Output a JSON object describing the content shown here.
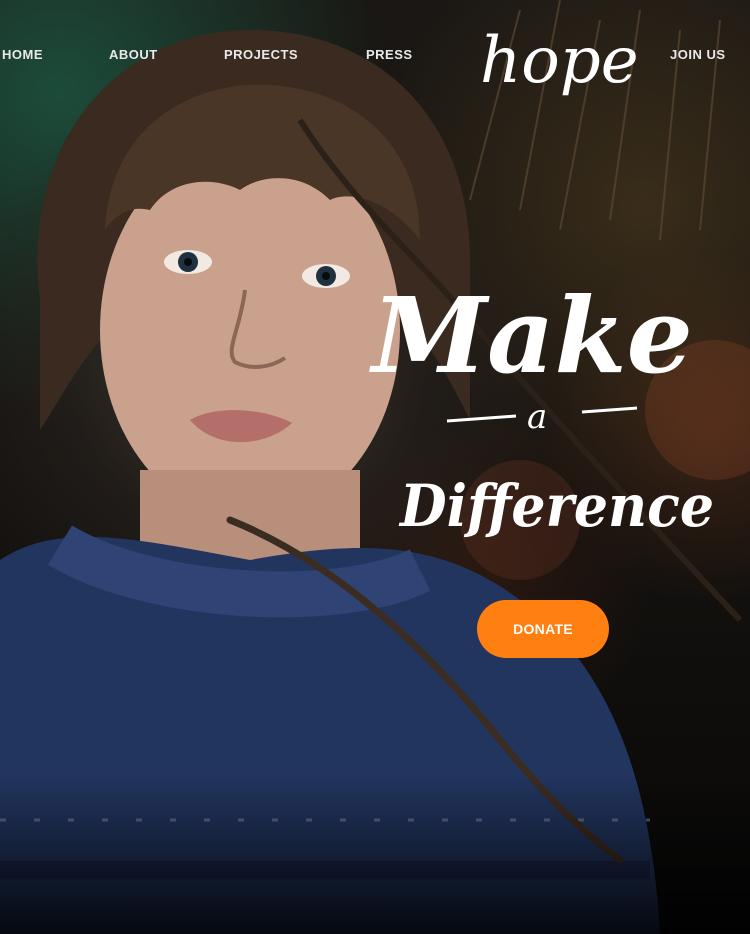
{
  "nav": {
    "items": [
      {
        "label": "HOME"
      },
      {
        "label": "ABOUT"
      },
      {
        "label": "PROJECTS"
      },
      {
        "label": "PRESS"
      },
      {
        "label": "JOIN US"
      }
    ],
    "logo_text": "hope"
  },
  "hero": {
    "line1": "Make",
    "line2": "a",
    "line3": "Difference",
    "cta_label": "DONATE",
    "cta_color": "#ff7f10",
    "image_subject": "child-portrait-photo"
  }
}
